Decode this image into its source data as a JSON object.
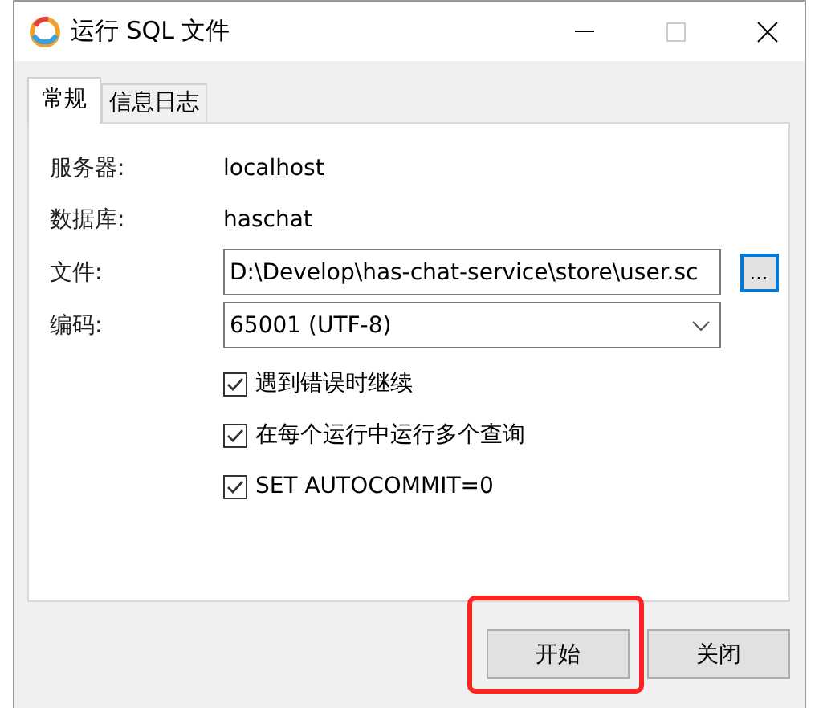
{
  "window": {
    "title": "运行 SQL 文件"
  },
  "tabs": [
    {
      "label": "常规",
      "selected": true
    },
    {
      "label": "信息日志",
      "selected": false
    }
  ],
  "info": [
    {
      "label": "服务器:",
      "value": "localhost"
    },
    {
      "label": "数据库:",
      "value": "haschat"
    }
  ],
  "file": {
    "label": "文件:",
    "value": "D:\\Develop\\has-chat-service\\store\\user.sc",
    "browse": "..."
  },
  "encoding": {
    "label": "编码:",
    "value": "65001 (UTF-8)"
  },
  "options": [
    {
      "label": "遇到错误时继续",
      "checked": true
    },
    {
      "label": "在每个运行中运行多个查询",
      "checked": true
    },
    {
      "label": "SET AUTOCOMMIT=0",
      "checked": true
    }
  ],
  "buttons": [
    {
      "label": "开始",
      "highlighted": true
    },
    {
      "label": "关闭",
      "highlighted": false
    }
  ]
}
